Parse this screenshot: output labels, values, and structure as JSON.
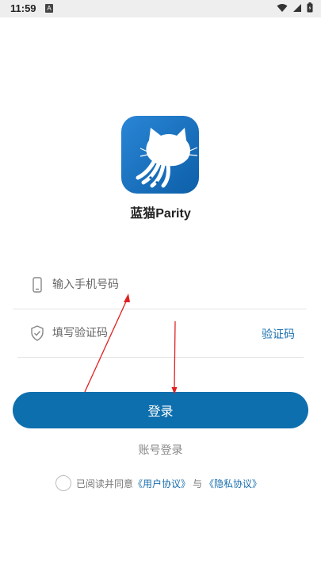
{
  "status_bar": {
    "time": "11:59",
    "notif": "A"
  },
  "app": {
    "name": "蓝猫Parity"
  },
  "form": {
    "phone_placeholder": "输入手机号码",
    "code_placeholder": "填写验证码",
    "get_code_label": "验证码"
  },
  "actions": {
    "login_label": "登录",
    "account_login_label": "账号登录"
  },
  "agreement": {
    "prefix": "已阅读并同意",
    "user_agreement": "《用户协议》",
    "and": "与",
    "privacy_agreement": "《隐私协议》"
  },
  "colors": {
    "accent": "#0e6fae",
    "annotation": "#e02020"
  }
}
